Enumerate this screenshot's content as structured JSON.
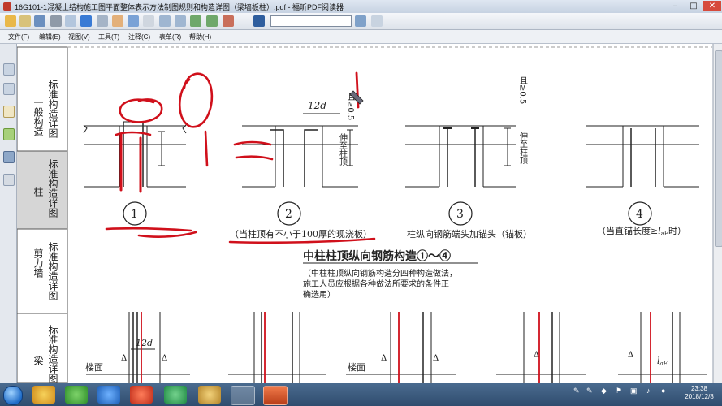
{
  "window": {
    "title": "16G101-1混凝土结构施工图平面整体表示方法制图规则和构造详图（梁墙板柱）.pdf - 福昕PDF阅读器",
    "controls": [
      "–",
      "□",
      "✕"
    ]
  },
  "toolbar": {
    "search_value": ""
  },
  "menu": [
    "文件(F)",
    "编辑(E)",
    "视图(V)",
    "工具(T)",
    "注释(C)",
    "表单(R)",
    "帮助(H)"
  ],
  "document": {
    "sidebar": {
      "sections": [
        {
          "label": "标准构造详图",
          "sub": "一般构造"
        },
        {
          "label": "标准构造详图",
          "sub": "柱"
        },
        {
          "label": "标准构造详图",
          "sub": "剪力墙"
        },
        {
          "label": "标准构造详图",
          "sub": "梁"
        }
      ]
    },
    "dimension_12d": "12d",
    "dim_anchor_label": "且≥0.5",
    "dim_anchor_sub": "l",
    "dim_anchor_subscript": "abE",
    "extend_label": "伸至柱顶",
    "diagrams": [
      {
        "num": "1",
        "caption": ""
      },
      {
        "num": "2",
        "caption": "（当柱顶有不小于100厚的现浇板）"
      },
      {
        "num": "3",
        "caption": "柱纵向钢筋端头加锚头（锚板）"
      },
      {
        "num": "4",
        "caption_pre": "（当直锚长度≥",
        "caption_l": "l",
        "caption_sub": "aE",
        "caption_post": "时）"
      }
    ],
    "section_title": "中柱柱顶纵向钢筋构造①～④",
    "note_lines": [
      "（中柱柱顶纵向钢筋构造分四种构造做法，",
      "施工人员应根据各种做法所要求的条件正",
      "确选用）"
    ],
    "bottom_labels": {
      "floor": "楼面",
      "dim": "12d",
      "delta": "Δ",
      "le": "l",
      "le_sub": "aE"
    }
  },
  "taskbar": {
    "clock_time": "23:38",
    "clock_date": "2018/12/8",
    "tray_icons": [
      "pen-icon",
      "pen-icon",
      "shield-icon",
      "network-icon",
      "volume-icon",
      "flag-icon"
    ]
  },
  "colors": {
    "annotation_red": "#d0101b",
    "rebar_red": "#d0101b",
    "line_black": "#222222"
  }
}
